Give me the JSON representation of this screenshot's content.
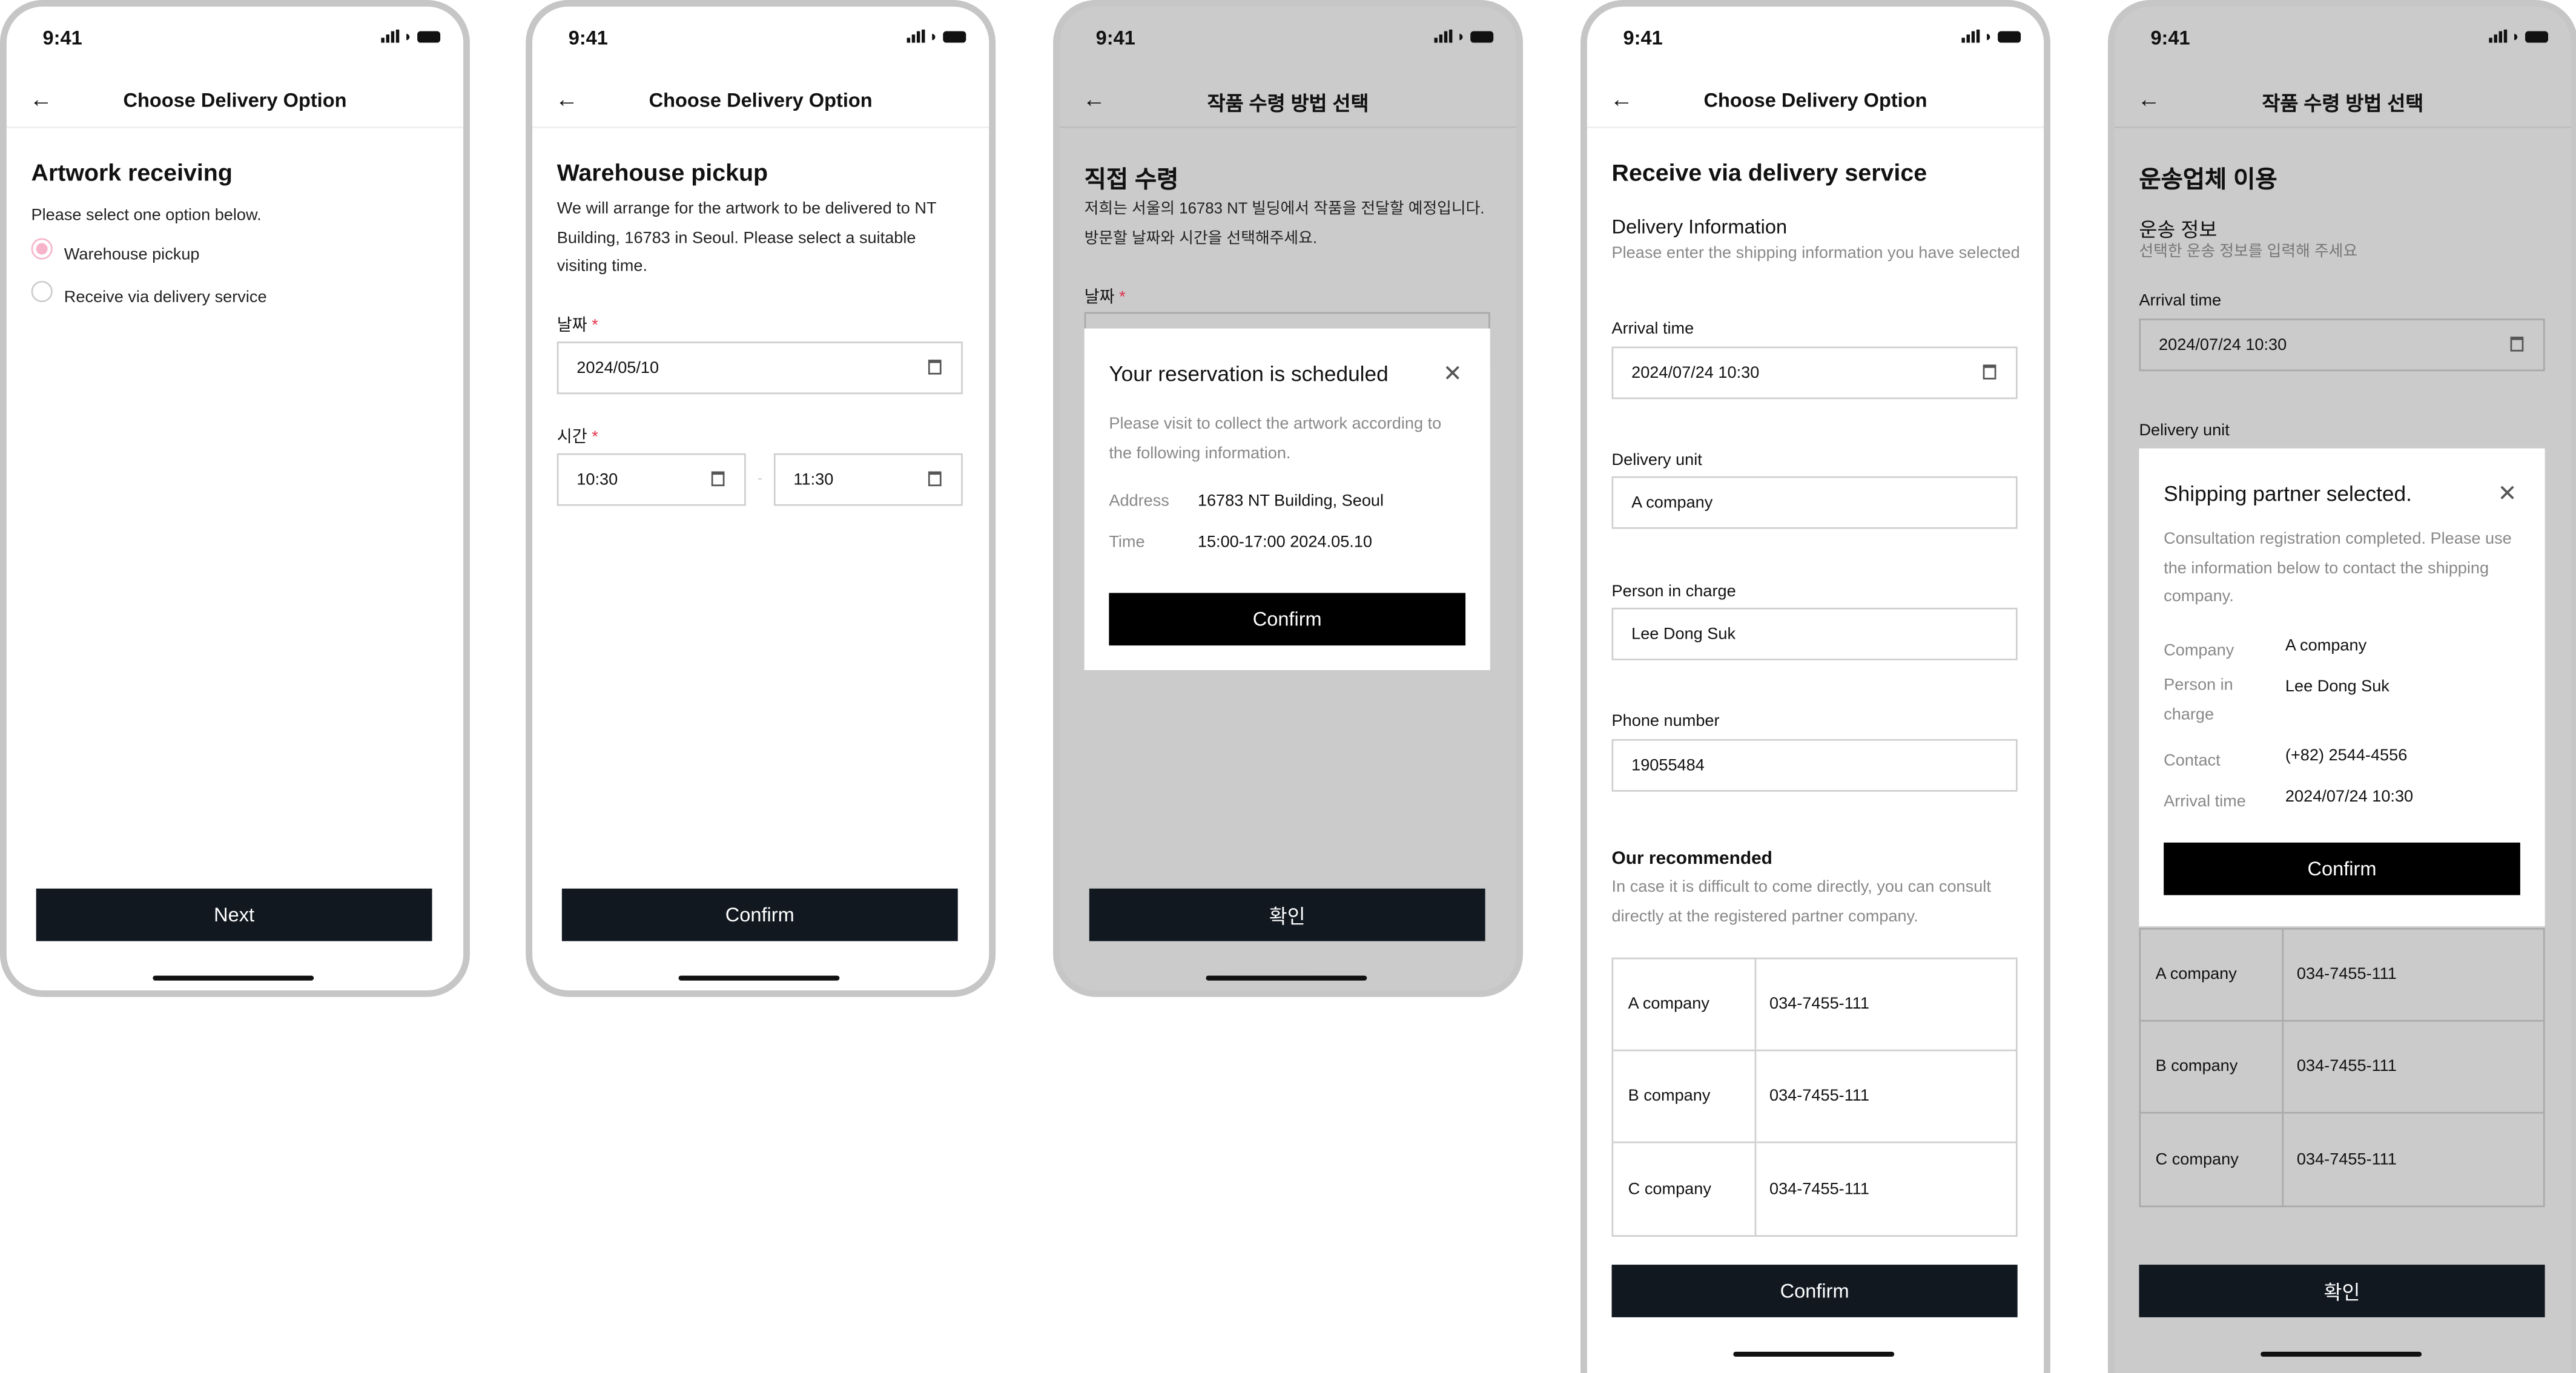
{
  "status": {
    "time": "9:41"
  },
  "screens": [
    {
      "header": "Choose Delivery Option",
      "title": "Artwork receiving",
      "subtitle": "Please select one option below.",
      "options": [
        {
          "label": "Warehouse pickup",
          "selected": true
        },
        {
          "label": "Receive via delivery service",
          "selected": false
        }
      ],
      "button": "Next"
    },
    {
      "header": "Choose Delivery Option",
      "title": "Warehouse pickup",
      "description": "We will arrange for the artwork to be delivered to NT Building, 16783 in Seoul. Please select a suitable visiting time.",
      "date_label": "날짜",
      "date_value": "2024/05/10",
      "time_label": "시간",
      "time_from": "10:30",
      "time_to": "11:30",
      "button": "Confirm"
    },
    {
      "header": "작품 수령 방법 선택",
      "title": "직접 수령",
      "description": "저희는 서울의 16783 NT 빌딩에서 작품을 전달할 예정입니다. 방문할 날짜와 시간을 선택해주세요.",
      "date_label": "날짜",
      "button": "확인",
      "modal": {
        "title": "Your reservation is scheduled",
        "description": "Please visit to collect the artwork according to the following information.",
        "rows": [
          {
            "key": "Address",
            "value": "16783 NT Building, Seoul"
          },
          {
            "key": "Time",
            "value": "15:00-17:00 2024.05.10"
          }
        ],
        "button": "Confirm"
      }
    },
    {
      "header": "Choose Delivery Option",
      "title": "Receive via delivery service",
      "section": "Delivery Information",
      "section_desc": "Please enter the shipping information you have selected",
      "fields": [
        {
          "label": "Arrival time",
          "value": "2024/07/24 10:30"
        },
        {
          "label": "Delivery unit",
          "value": "A company"
        },
        {
          "label": "Person in charge",
          "value": "Lee Dong Suk"
        },
        {
          "label": "Phone number",
          "value": "19055484"
        }
      ],
      "recommended_title": "Our recommended",
      "recommended_desc": "In case it is difficult to come directly, you can consult directly at the registered partner company.",
      "partners": [
        {
          "name": "A company",
          "phone": "034-7455-111"
        },
        {
          "name": "B company",
          "phone": "034-7455-111"
        },
        {
          "name": "C company",
          "phone": "034-7455-111"
        }
      ],
      "button": "Confirm"
    },
    {
      "header": "작품 수령 방법 선택",
      "title": "운송업체 이용",
      "section": "운송 정보",
      "section_desc": "선택한 운송 정보를 입력해 주세요",
      "arrival_label": "Arrival time",
      "arrival_value": "2024/07/24 10:30",
      "unit_label": "Delivery unit",
      "modal": {
        "title": "Shipping partner selected.",
        "description": "Consultation registration completed. Please use the information below to contact the shipping company.",
        "rows": [
          {
            "key": "Company",
            "value": "A company"
          },
          {
            "key": "Person in charge",
            "value": "Lee Dong Suk"
          },
          {
            "key": "Contact",
            "value": "(+82) 2544-4556"
          },
          {
            "key": "Arrival time",
            "value": "2024/07/24 10:30"
          }
        ],
        "button": "Confirm"
      },
      "partners": [
        {
          "name": "A company",
          "phone": "034-7455-111"
        },
        {
          "name": "B company",
          "phone": "034-7455-111"
        },
        {
          "name": "C company",
          "phone": "034-7455-111"
        }
      ],
      "button": "확인"
    }
  ],
  "colors": {
    "primary_button": "#111820",
    "modal_button": "#000000",
    "radio_selected": "#f7b3c9",
    "required": "#e0324b",
    "overlay": "#cbcbcb"
  }
}
